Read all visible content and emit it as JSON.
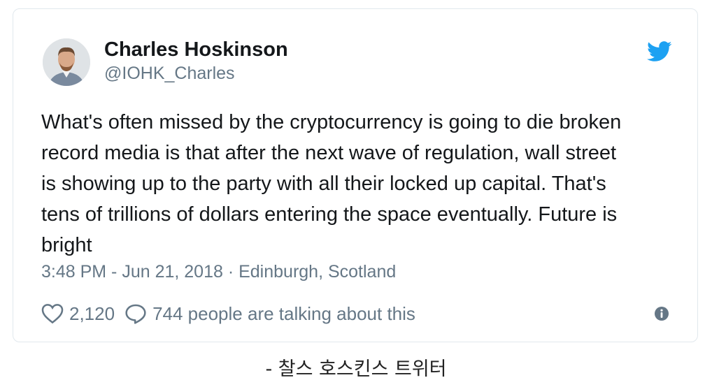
{
  "tweet": {
    "author_name": "Charles Hoskinson",
    "author_handle": "@IOHK_Charles",
    "text_lines": [
      "What's often missed by the cryptocurrency is going to die broken",
      "record media is that after the next wave of regulation, wall street",
      "is showing up to the party with all their locked up capital. That's",
      "tens of trillions of dollars entering the space eventually. Future is",
      "bright"
    ],
    "meta": "3:48 PM - Jun 21, 2018 · Edinburgh, Scotland",
    "likes": "2,120",
    "talking": "744 people are talking about this",
    "icons": {
      "platform": "twitter-bird-icon",
      "like": "heart-icon",
      "reply": "speech-bubble-icon",
      "info": "info-icon"
    },
    "colors": {
      "brand": "#1da1f2",
      "secondary_text": "#657786",
      "primary_text": "#14171a"
    }
  },
  "caption": "- 찰스 호스킨스 트위터"
}
